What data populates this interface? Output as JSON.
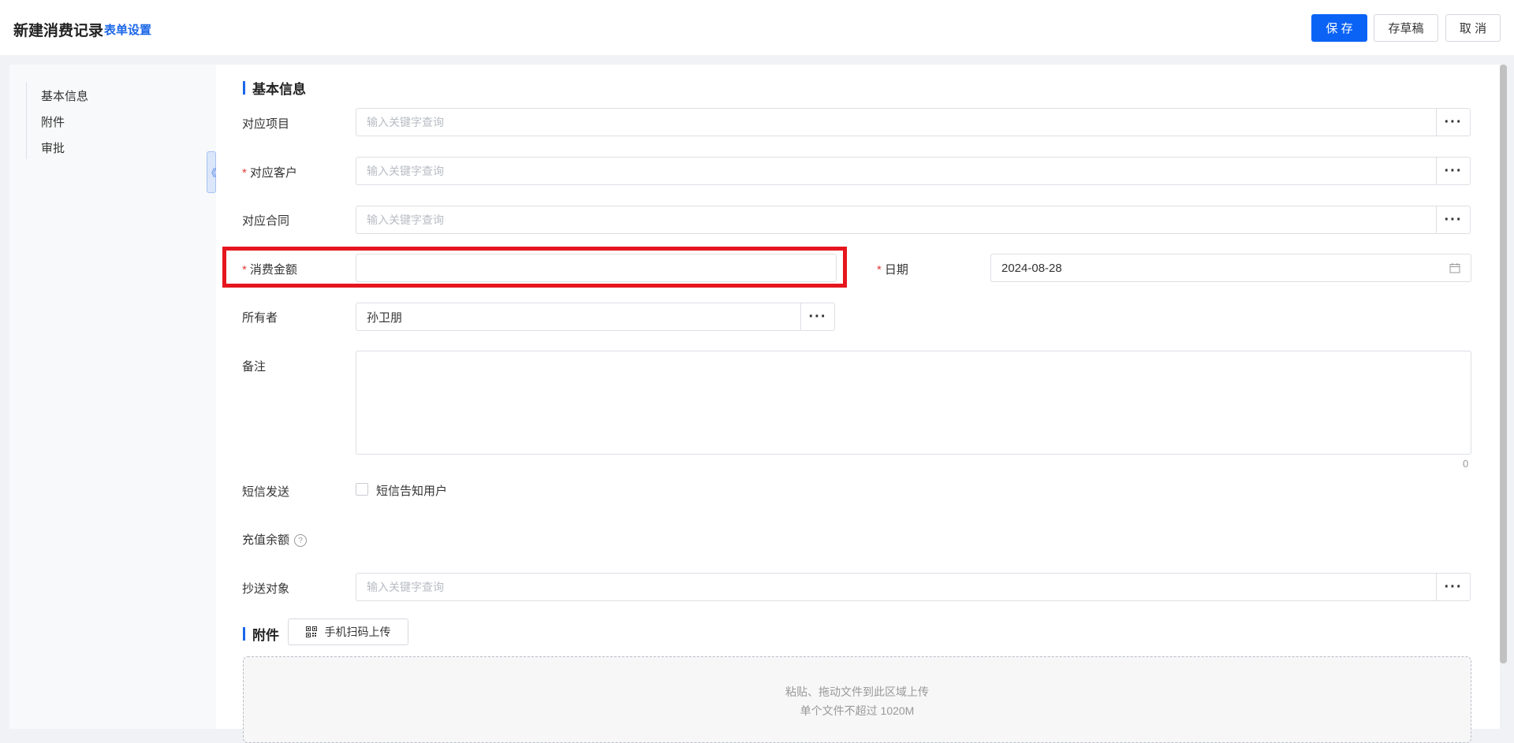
{
  "header": {
    "title": "新建消费记录",
    "form_settings": "表单设置",
    "save_label": "保 存",
    "draft_label": "存草稿",
    "cancel_label": "取 消"
  },
  "nav": {
    "items": [
      "基本信息",
      "附件",
      "审批"
    ],
    "collapse_icon": "《"
  },
  "form": {
    "section_basic": "基本信息",
    "fields": {
      "project": {
        "label": "对应项目",
        "placeholder": "输入关键字查询"
      },
      "customer": {
        "label": "对应客户",
        "placeholder": "输入关键字查询",
        "required": "*"
      },
      "contract": {
        "label": "对应合同",
        "placeholder": "输入关键字查询"
      },
      "amount": {
        "label": "消费金额",
        "value": "",
        "required": "*"
      },
      "date": {
        "label": "日期",
        "value": "2024-08-28",
        "required": "*"
      },
      "owner": {
        "label": "所有者",
        "value": "孙卫朋"
      },
      "remark": {
        "label": "备注",
        "count": "0"
      },
      "sms": {
        "label": "短信发送",
        "checkbox_label": "短信告知用户",
        "checked": false
      },
      "balance": {
        "label": "充值余额",
        "help_icon": "?"
      },
      "cc": {
        "label": "抄送对象",
        "placeholder": "输入关键字查询"
      }
    },
    "more_icon": "···"
  },
  "attachment": {
    "section_title": "附件",
    "scan_upload": "手机扫码上传",
    "drop_text": "粘贴、拖动文件到此区域上传",
    "size_limit": "单个文件不超过 1020M"
  },
  "colors": {
    "primary": "#0b63f6",
    "link": "#1a66e8",
    "required": "#e23c3c",
    "highlight": "#e5161d"
  }
}
